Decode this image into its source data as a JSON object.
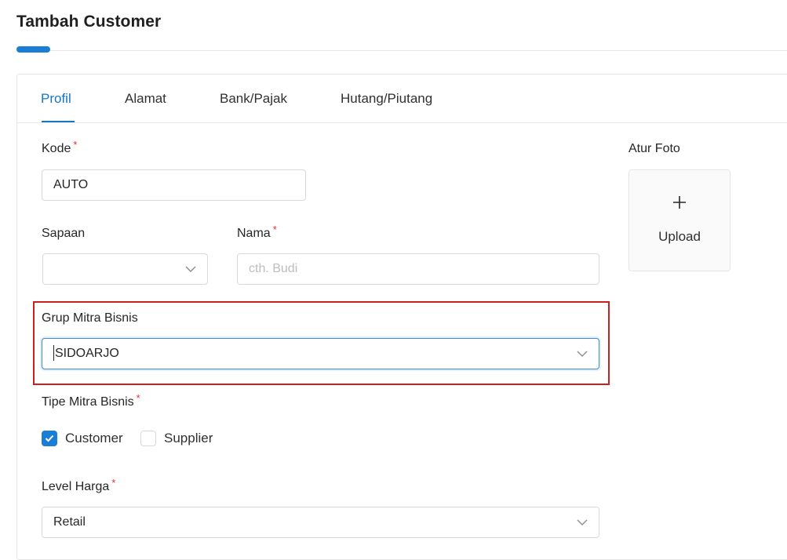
{
  "page": {
    "title": "Tambah Customer"
  },
  "tabs": [
    {
      "label": "Profil",
      "active": true
    },
    {
      "label": "Alamat",
      "active": false
    },
    {
      "label": "Bank/Pajak",
      "active": false
    },
    {
      "label": "Hutang/Piutang",
      "active": false
    }
  ],
  "form": {
    "kode": {
      "label": "Kode",
      "required": "*",
      "value": "AUTO"
    },
    "sapaan": {
      "label": "Sapaan",
      "value": ""
    },
    "nama": {
      "label": "Nama",
      "required": "*",
      "value": "",
      "placeholder": "cth. Budi"
    },
    "grup_mitra_bisnis": {
      "label": "Grup Mitra Bisnis",
      "value": "SIDOARJO"
    },
    "tipe_mitra_bisnis": {
      "label": "Tipe Mitra Bisnis",
      "required": "*",
      "options": [
        {
          "label": "Customer",
          "checked": true
        },
        {
          "label": "Supplier",
          "checked": false
        }
      ]
    },
    "level_harga": {
      "label": "Level Harga",
      "required": "*",
      "value": "Retail"
    }
  },
  "photo": {
    "label": "Atur Foto",
    "upload_label": "Upload"
  },
  "colors": {
    "accent": "#1a7fd4",
    "required": "#e03131",
    "highlight": "#cc1f1f"
  }
}
